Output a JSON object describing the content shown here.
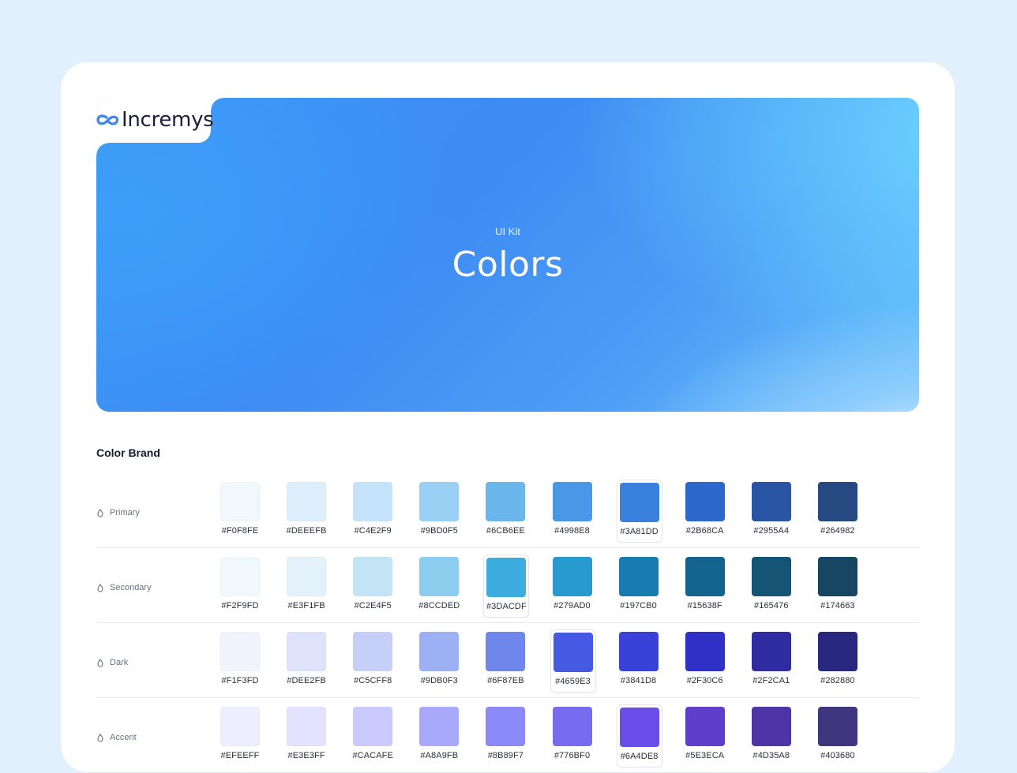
{
  "brand": {
    "name": "Incremys"
  },
  "hero": {
    "subtitle": "UI Kit",
    "title": "Colors"
  },
  "section": {
    "title": "Color Brand"
  },
  "palettes": [
    {
      "name": "Primary",
      "selected_index": 6,
      "colors": [
        "#F0F8FE",
        "#DEEEFB",
        "#C4E2F9",
        "#9BD0F5",
        "#6CB6EE",
        "#4998E8",
        "#3A81DD",
        "#2B68CA",
        "#2955A4",
        "#264982"
      ]
    },
    {
      "name": "Secondary",
      "selected_index": 4,
      "colors": [
        "#F2F9FD",
        "#E3F1FB",
        "#C2E4F5",
        "#8CCDED",
        "#3DACDF",
        "#279AD0",
        "#197CB0",
        "#15638F",
        "#165476",
        "#174663"
      ]
    },
    {
      "name": "Dark",
      "selected_index": 5,
      "colors": [
        "#F1F3FD",
        "#DEE2FB",
        "#C5CFF8",
        "#9DB0F3",
        "#6F87EB",
        "#4659E3",
        "#3841D8",
        "#2F30C6",
        "#2F2CA1",
        "#282880"
      ]
    },
    {
      "name": "Accent",
      "selected_index": 6,
      "colors": [
        "#EFEEFF",
        "#E3E3FF",
        "#CACAFE",
        "#A8A9FB",
        "#8B89F7",
        "#776BF0",
        "#6A4DE8",
        "#5E3ECA",
        "#4D35A8",
        "#403680"
      ]
    }
  ]
}
